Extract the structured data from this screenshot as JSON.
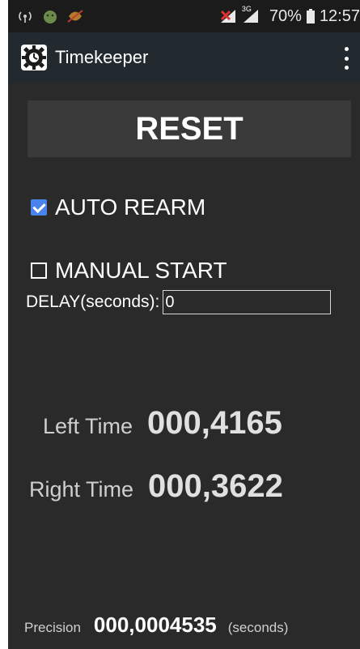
{
  "status_bar": {
    "network_type": "3G",
    "battery": "70%",
    "time": "12:57",
    "icons": [
      "signal-radar-icon",
      "android-robot-icon",
      "sync-off-icon",
      "signal-off-icon",
      "signal-3g-icon",
      "battery-icon"
    ]
  },
  "app_bar": {
    "title": "Timekeeper",
    "logo_icon": "gear-logo-icon",
    "menu_icon": "overflow-menu-icon"
  },
  "reset": {
    "label": "RESET"
  },
  "options": {
    "auto_rearm": {
      "label": "AUTO REARM",
      "checked": true
    },
    "manual_start": {
      "label": "MANUAL START",
      "checked": false
    }
  },
  "delay": {
    "label": "DELAY(seconds):",
    "value": "0"
  },
  "times": {
    "left_label": "Left Time",
    "left_value": "000,4165",
    "right_label": "Right Time",
    "right_value": "000,3622"
  },
  "precision": {
    "label": "Precision",
    "value": "000,0004535",
    "unit": "(seconds)"
  },
  "colors": {
    "background": "#2a2a2a",
    "app_bar": "#222a30",
    "checkbox_accent": "#4a83f0"
  }
}
